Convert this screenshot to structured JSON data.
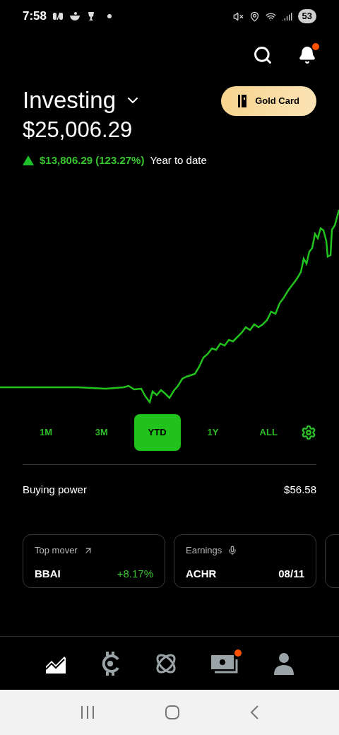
{
  "status_bar": {
    "time": "7:58",
    "battery": "53"
  },
  "header": {
    "notifications_badge": true
  },
  "account": {
    "title": "Investing",
    "gold_button": "Gold Card",
    "value": "$25,006.29",
    "change": "$13,806.29 (123.27%)",
    "gain": true,
    "period": "Year to date"
  },
  "ranges": [
    {
      "label": "1M",
      "selected": false
    },
    {
      "label": "3M",
      "selected": false
    },
    {
      "label": "YTD",
      "selected": true
    },
    {
      "label": "1Y",
      "selected": false
    },
    {
      "label": "ALL",
      "selected": false
    }
  ],
  "buying_power": {
    "label": "Buying power",
    "value": "$56.58"
  },
  "cards": [
    {
      "kind": "mover",
      "title": "Top mover",
      "symbol": "BBAI",
      "value": "+8.17%"
    },
    {
      "kind": "earnings",
      "title": "Earnings",
      "symbol": "ACHR",
      "value": "08/11"
    },
    {
      "kind": "partial"
    }
  ],
  "nav": [
    {
      "kind": "chart",
      "selected": true,
      "badge": false
    },
    {
      "kind": "crypto",
      "selected": false,
      "badge": false
    },
    {
      "kind": "orbit",
      "selected": false,
      "badge": false
    },
    {
      "kind": "cash",
      "selected": false,
      "badge": true
    },
    {
      "kind": "person",
      "selected": false,
      "badge": false
    }
  ]
}
